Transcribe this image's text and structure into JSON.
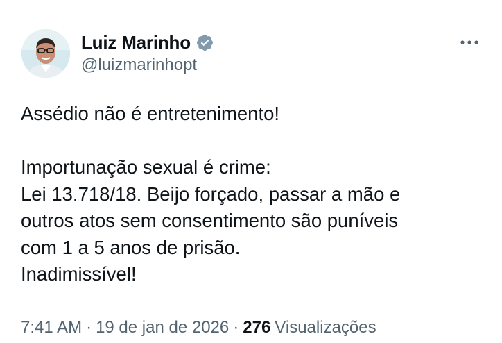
{
  "author": {
    "display_name": "Luiz Marinho",
    "handle": "@luizmarinhopt",
    "verified": true,
    "verified_color": "#829aab"
  },
  "tweet": {
    "lines": [
      "Assédio não é entretenimento!",
      "",
      "Importunação sexual é crime:",
      "Lei 13.718/18. Beijo forçado, passar a mão e",
      "outros atos sem consentimento são puníveis",
      "com 1 a 5 anos de prisão.",
      "Inadimissível!"
    ]
  },
  "meta": {
    "time": "7:41 AM",
    "separator": "·",
    "date": "19 de jan de 2026",
    "views_count": "276",
    "views_label": "Visualizações"
  },
  "icons": {
    "more": "more-horizontal-icon",
    "verified": "verified-badge-icon"
  },
  "colors": {
    "text_primary": "#0f1419",
    "text_secondary": "#536471"
  }
}
